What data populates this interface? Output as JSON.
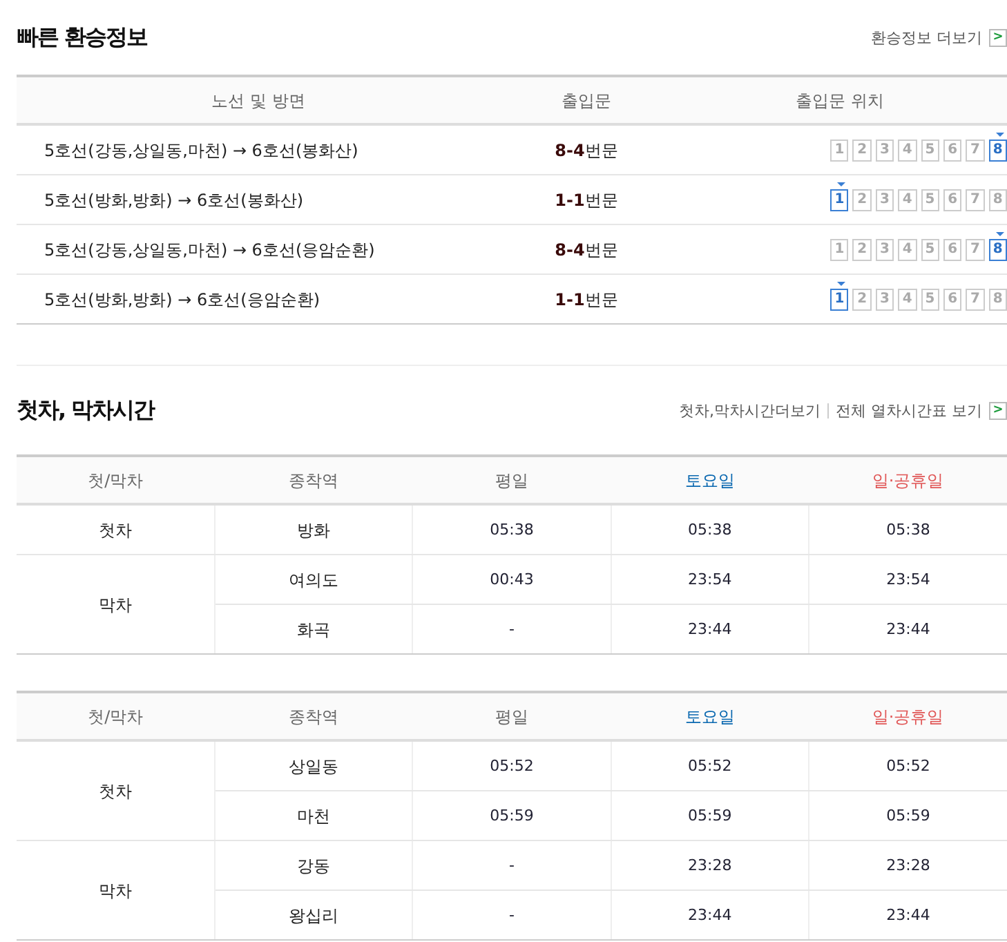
{
  "transfer": {
    "title": "빠른 환승정보",
    "more_link": "환승정보 더보기",
    "more_icon": ">",
    "columns": [
      "노선 및 방면",
      "출입문",
      "출입문 위치"
    ],
    "rows": [
      {
        "route": "5호선(강동,상일동,마천) → 6호선(봉화산)",
        "gate": "**8-4**번문",
        "doors": [
          {
            "label": "1",
            "selected": false
          },
          {
            "label": "2",
            "selected": false
          },
          {
            "label": "3",
            "selected": false
          },
          {
            "label": "4",
            "selected": false
          },
          {
            "label": "5",
            "selected": false
          },
          {
            "label": "6",
            "selected": false
          },
          {
            "label": "7",
            "selected": false
          },
          {
            "label": "8",
            "selected": true
          }
        ]
      },
      {
        "route": "5호선(방화,방화) → 6호선(봉화산)",
        "gate": "**1-1**번문",
        "doors": [
          {
            "label": "1",
            "selected": true
          },
          {
            "label": "2",
            "selected": false
          },
          {
            "label": "3",
            "selected": false
          },
          {
            "label": "4",
            "selected": false
          },
          {
            "label": "5",
            "selected": false
          },
          {
            "label": "6",
            "selected": false
          },
          {
            "label": "7",
            "selected": false
          },
          {
            "label": "8",
            "selected": false
          }
        ]
      },
      {
        "route": "5호선(강동,상일동,마천) → 6호선(응암순환)",
        "gate": "**8-4**번문",
        "doors": [
          {
            "label": "1",
            "selected": false
          },
          {
            "label": "2",
            "selected": false
          },
          {
            "label": "3",
            "selected": false
          },
          {
            "label": "4",
            "selected": false
          },
          {
            "label": "5",
            "selected": false
          },
          {
            "label": "6",
            "selected": false
          },
          {
            "label": "7",
            "selected": false
          },
          {
            "label": "8",
            "selected": true
          }
        ]
      },
      {
        "route": "5호선(방화,방화) → 6호선(응암순환)",
        "gate": "**1-1**번문",
        "doors": [
          {
            "label": "1",
            "selected": true
          },
          {
            "label": "2",
            "selected": false
          },
          {
            "label": "3",
            "selected": false
          },
          {
            "label": "4",
            "selected": false
          },
          {
            "label": "5",
            "selected": false
          },
          {
            "label": "6",
            "selected": false
          },
          {
            "label": "7",
            "selected": false
          },
          {
            "label": "8",
            "selected": false
          }
        ]
      }
    ]
  },
  "timetable": {
    "title": "첫차, 막차시간",
    "links": [
      "첫차,막차시간더보기",
      "전체 열차시간표 보기"
    ],
    "more_icon": ">",
    "tables": [
      {
        "columns": [
          "첫/막차",
          "종착역",
          "평일",
          "토요일",
          "일·공휴일"
        ],
        "groups": [
          {
            "type": "첫차",
            "rows": [
              {
                "station": "방화",
                "weekday": "05:38",
                "saturday": "05:38",
                "holiday": "05:38"
              }
            ]
          },
          {
            "type": "막차",
            "rows": [
              {
                "station": "여의도",
                "weekday": "00:43",
                "saturday": "23:54",
                "holiday": "23:54"
              },
              {
                "station": "화곡",
                "weekday": "-",
                "saturday": "23:44",
                "holiday": "23:44"
              }
            ]
          }
        ]
      },
      {
        "columns": [
          "첫/막차",
          "종착역",
          "평일",
          "토요일",
          "일·공휴일"
        ],
        "groups": [
          {
            "type": "첫차",
            "rows": [
              {
                "station": "상일동",
                "weekday": "05:52",
                "saturday": "05:52",
                "holiday": "05:52"
              },
              {
                "station": "마천",
                "weekday": "05:59",
                "saturday": "05:59",
                "holiday": "05:59"
              }
            ]
          },
          {
            "type": "막차",
            "rows": [
              {
                "station": "강동",
                "weekday": "-",
                "saturday": "23:28",
                "holiday": "23:28"
              },
              {
                "station": "왕십리",
                "weekday": "-",
                "saturday": "23:44",
                "holiday": "23:44"
              }
            ]
          }
        ]
      }
    ]
  }
}
